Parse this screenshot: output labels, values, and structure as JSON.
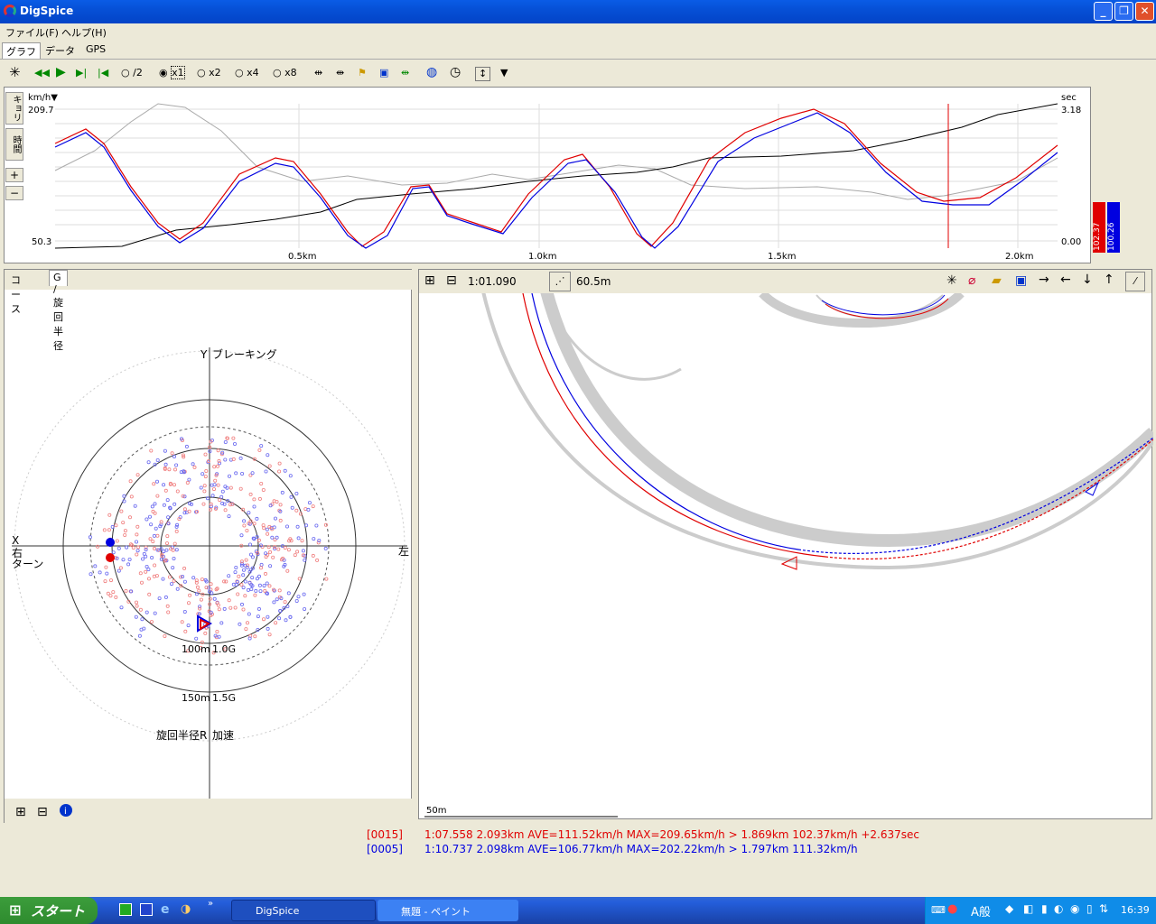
{
  "window": {
    "title": "DigSpice"
  },
  "menu": [
    "ファイル(F)",
    "ヘルプ(H)"
  ],
  "tabs": [
    "グラフ",
    "データ",
    "GPS"
  ],
  "toolbar": {
    "speeds": [
      "/2",
      "x1",
      "x2",
      "x4",
      "x8"
    ],
    "selected_speed": "x1"
  },
  "graph": {
    "side_tabs": [
      "キョリ",
      "時間"
    ],
    "y_unit": "km/h▼",
    "y_max": "209.7",
    "y_min": "50.3",
    "y2_unit": "sec",
    "y2_max": "3.18",
    "y2_min": "0.00",
    "x_ticks": [
      "0.5km",
      "1.0km",
      "1.5km",
      "2.0km"
    ],
    "legend_red": "102.37",
    "legend_blue": "100.26",
    "colors": {
      "red": "#e00000",
      "blue": "#0000e0"
    }
  },
  "left_panel": {
    "tabs": [
      "コース",
      "G / 旋回半径"
    ],
    "label_y": "Y",
    "label_braking": "ブレーキング",
    "label_x": "X",
    "label_right": "右",
    "label_turn": "ターン",
    "label_left": "左",
    "ring_100m": "100m",
    "ring_1g": "1.0G",
    "ring_150m": "150m",
    "ring_15g": "1.5G",
    "label_radius": "旋回半径R",
    "label_accel": "加速"
  },
  "right_panel": {
    "lap_time": "1:01.090",
    "distance": "60.5m",
    "scale": "50m"
  },
  "status": {
    "red_id": "[0015]",
    "red_text": "1:07.558 2.093km AVE=111.52km/h MAX=209.65km/h > 1.869km 102.37km/h +2.637sec",
    "blue_id": "[0005]",
    "blue_text": "1:10.737 2.098km AVE=106.77km/h MAX=202.22km/h > 1.797km 111.32km/h"
  },
  "taskbar": {
    "start": "スタート",
    "tasks": [
      "DigSpice",
      "無題 - ペイント"
    ],
    "tray_ime": "A般",
    "clock": "16:39"
  }
}
